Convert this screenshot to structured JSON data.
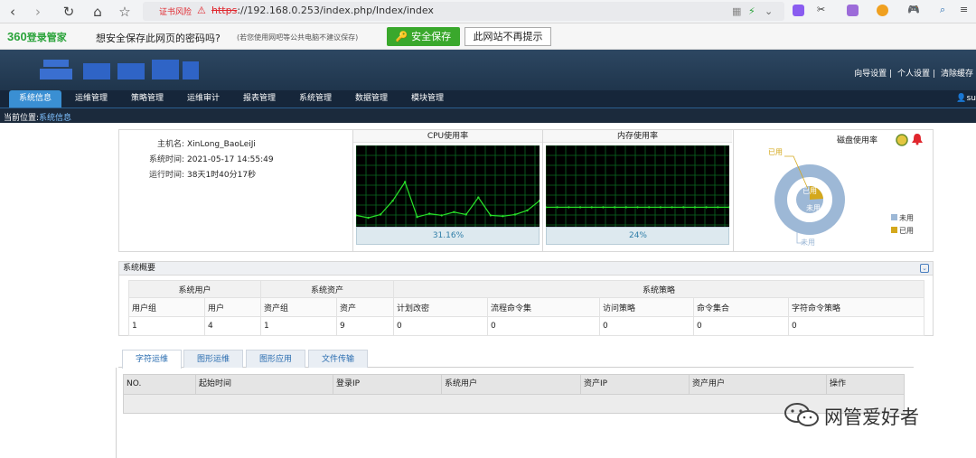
{
  "browser": {
    "cert_warning": "证书风险",
    "url_scheme": "https",
    "url_rest": "://192.168.0.253/index.php/Index/index",
    "nav_icons": [
      "back-icon",
      "forward-icon",
      "reload-icon",
      "home-icon",
      "star-icon"
    ]
  },
  "savebar": {
    "brand_num": "360",
    "brand_text": "登录管家",
    "question": "想安全保存此网页的密码吗?",
    "note": "(若您使用网吧等公共电脑不建议保存)",
    "save_label": "安全保存",
    "never_label": "此网站不再提示"
  },
  "header": {
    "links": [
      "向导设置",
      "个人设置",
      "清除缓存"
    ],
    "user": "su"
  },
  "menu": {
    "items": [
      "系统信息",
      "运维管理",
      "策略管理",
      "运维审计",
      "报表管理",
      "系统管理",
      "数据管理",
      "模块管理"
    ],
    "active_index": 0
  },
  "crumb": {
    "label": "当前位置:",
    "value": "系统信息"
  },
  "sysinfo": {
    "hostname_label": "主机名:",
    "hostname": "XinLong_BaoLeiJi",
    "time_label": "系统时间:",
    "time": "2021-05-17 14:55:49",
    "uptime_label": "运行时间:",
    "uptime": "38天1时40分17秒"
  },
  "cpu": {
    "title": "CPU使用率",
    "usage": "31.16%",
    "history": [
      0.14,
      0.11,
      0.15,
      0.32,
      0.55,
      0.12,
      0.16,
      0.14,
      0.18,
      0.15,
      0.36,
      0.14,
      0.13,
      0.15,
      0.2,
      0.32
    ]
  },
  "mem": {
    "title": "内存使用率",
    "usage": "24%",
    "history": [
      0.24,
      0.24,
      0.24,
      0.24,
      0.24,
      0.24,
      0.24,
      0.24,
      0.24,
      0.24,
      0.24,
      0.24,
      0.24,
      0.24,
      0.24,
      0.24,
      0.24
    ]
  },
  "disk": {
    "title": "磁盘使用率",
    "used_fraction": 0.08,
    "used_label": "已用",
    "unused_label": "未用",
    "legend_unused": "未用",
    "legend_used": "已用",
    "color_unused": "#9db8d6",
    "color_used": "#d4a81c"
  },
  "summary": {
    "title": "系统概要",
    "groups": [
      "系统用户",
      "系统资产",
      "系统策略"
    ],
    "headers": [
      "用户组",
      "用户",
      "资产组",
      "资产",
      "计划改密",
      "流程命令集",
      "访问策略",
      "命令集合",
      "字符命令策略"
    ],
    "values": [
      "1",
      "4",
      "1",
      "9",
      "0",
      "0",
      "0",
      "0",
      "0"
    ]
  },
  "tabs": [
    "字符运维",
    "图形运维",
    "图形应用",
    "文件传输"
  ],
  "session": {
    "columns": [
      "NO.",
      "起始时间",
      "登录IP",
      "系统用户",
      "资产IP",
      "资产用户",
      "操作"
    ]
  },
  "watermark": "网管爱好者"
}
